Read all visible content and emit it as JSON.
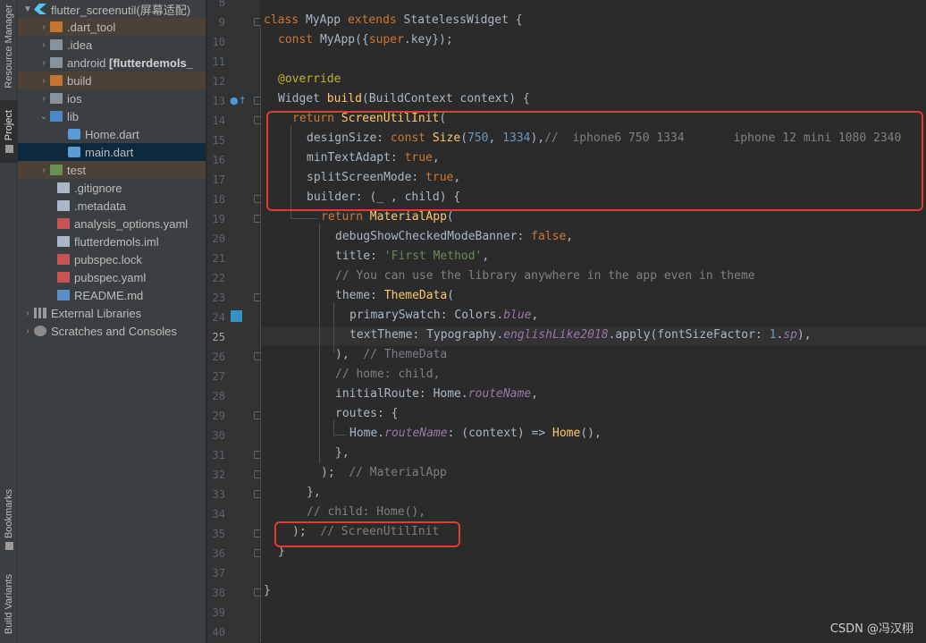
{
  "tool_strip": {
    "resource_manager": "Resource Manager",
    "project": "Project",
    "bookmarks": "Bookmarks",
    "build_variants": "Build Variants"
  },
  "tree": {
    "root": "flutter_screenutil(屏幕适配)",
    "dart_tool": ".dart_tool",
    "idea": ".idea",
    "android": "android",
    "android_module": "[flutterdemols_",
    "build": "build",
    "ios": "ios",
    "lib": "lib",
    "home_dart": "Home.dart",
    "main_dart": "main.dart",
    "test": "test",
    "gitignore": ".gitignore",
    "metadata": ".metadata",
    "analysis_options": "analysis_options.yaml",
    "iml": "flutterdemols.iml",
    "pubspec_lock": "pubspec.lock",
    "pubspec_yaml": "pubspec.yaml",
    "readme": "README.md",
    "external_libraries": "External Libraries",
    "scratches": "Scratches and Consoles"
  },
  "line_numbers": [
    "8",
    "9",
    "10",
    "11",
    "12",
    "13",
    "14",
    "15",
    "16",
    "17",
    "18",
    "19",
    "20",
    "21",
    "22",
    "23",
    "24",
    "25",
    "26",
    "27",
    "28",
    "29",
    "30",
    "31",
    "32",
    "33",
    "34",
    "35",
    "36",
    "37",
    "38",
    "39",
    "40"
  ],
  "code": {
    "l9_class": "class",
    "l9_name": " MyApp ",
    "l9_extends": "extends",
    "l9_rest": " StatelessWidget {",
    "l10_const": "const",
    "l10_a": " MyApp({",
    "l10_super": "super",
    "l10_b": ".key});",
    "l12_ann": "@override",
    "l13_a": "Widget ",
    "l13_fn": "build",
    "l13_b": "(BuildContext context) {",
    "l14_ret": "return ",
    "l14_fn": "ScreenUtilInit",
    "l14_b": "(",
    "l15_a": "designSize: ",
    "l15_const": "const ",
    "l15_fn": "Size",
    "l15_b": "(",
    "l15_n1": "750",
    "l15_c": ", ",
    "l15_n2": "1334",
    "l15_d": "),",
    "l15_cm": "//  iphone6 750 1334       iphone 12 mini 1080 2340",
    "l16_a": "minTextAdapt: ",
    "l16_v": "true",
    "l16_b": ",",
    "l17_a": "splitScreenMode: ",
    "l17_v": "true",
    "l17_b": ",",
    "l18_a": "builder: (_ , child) {",
    "l19_ret": "return ",
    "l19_fn": "MaterialApp",
    "l19_b": "(",
    "l20_a": "debugShowCheckedModeBanner: ",
    "l20_v": "false",
    "l20_b": ",",
    "l21_a": "title: ",
    "l21_s": "'First Method'",
    "l21_b": ",",
    "l22_cm": "// You can use the library anywhere in the app even in theme",
    "l23_a": "theme: ",
    "l23_fn": "ThemeData",
    "l23_b": "(",
    "l24_a": "primarySwatch: Colors.",
    "l24_it": "blue",
    "l24_b": ",",
    "l25_a": "textTheme: Typography.",
    "l25_it": "englishLike2018",
    "l25_b": ".apply(fontSizeFactor: ",
    "l25_n": "1",
    "l25_c": ".",
    "l25_it2": "sp",
    "l25_d": "),",
    "l26_a": "),  ",
    "l26_hint": "// ThemeData",
    "l27_cm": "// home: child,",
    "l28_a": "initialRoute: Home.",
    "l28_it": "routeName",
    "l28_b": ",",
    "l29_a": "routes: {",
    "l30_a": "Home.",
    "l30_it": "routeName",
    "l30_b": ": (context) => ",
    "l30_fn": "Home",
    "l30_c": "(),",
    "l31_a": "},",
    "l32_a": ");  ",
    "l32_hint": "// MaterialApp",
    "l33_a": "},",
    "l34_cm": "// child: Home(),",
    "l35_a": ");  ",
    "l35_hint": "// ScreenUtilInit",
    "l36_a": "}",
    "l38_a": "}"
  },
  "watermark": "CSDN @冯汉栩",
  "colors": {
    "highlight_box": "#e13c32",
    "editor_bg": "#2b2b2b",
    "panel_bg": "#3c3f41"
  }
}
